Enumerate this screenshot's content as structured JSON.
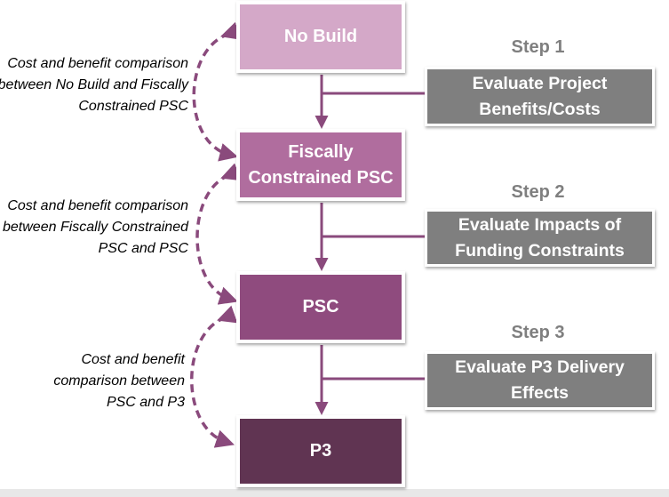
{
  "colors": {
    "no_build": "#d4a8c8",
    "fiscally_constrained": "#b06d9e",
    "psc": "#8f4b7e",
    "p3": "#603452",
    "connector": "#8a4a7c",
    "step_gray": "#7f7f7f"
  },
  "alternatives": [
    {
      "label": "No Build"
    },
    {
      "label": "Fiscally Constrained PSC"
    },
    {
      "label": "PSC"
    },
    {
      "label": "P3"
    }
  ],
  "steps": [
    {
      "number_label": "Step 1",
      "title": "Evaluate Project Benefits/Costs"
    },
    {
      "number_label": "Step 2",
      "title": "Evaluate Impacts of Funding Constraints"
    },
    {
      "number_label": "Step 3",
      "title": "Evaluate P3 Delivery Effects"
    }
  ],
  "comparisons": [
    {
      "text": "Cost and benefit comparison between No Build and Fiscally Constrained PSC"
    },
    {
      "text": "Cost and benefit comparison between Fiscally Constrained PSC and PSC"
    },
    {
      "text": "Cost and benefit comparison between PSC and P3"
    }
  ]
}
